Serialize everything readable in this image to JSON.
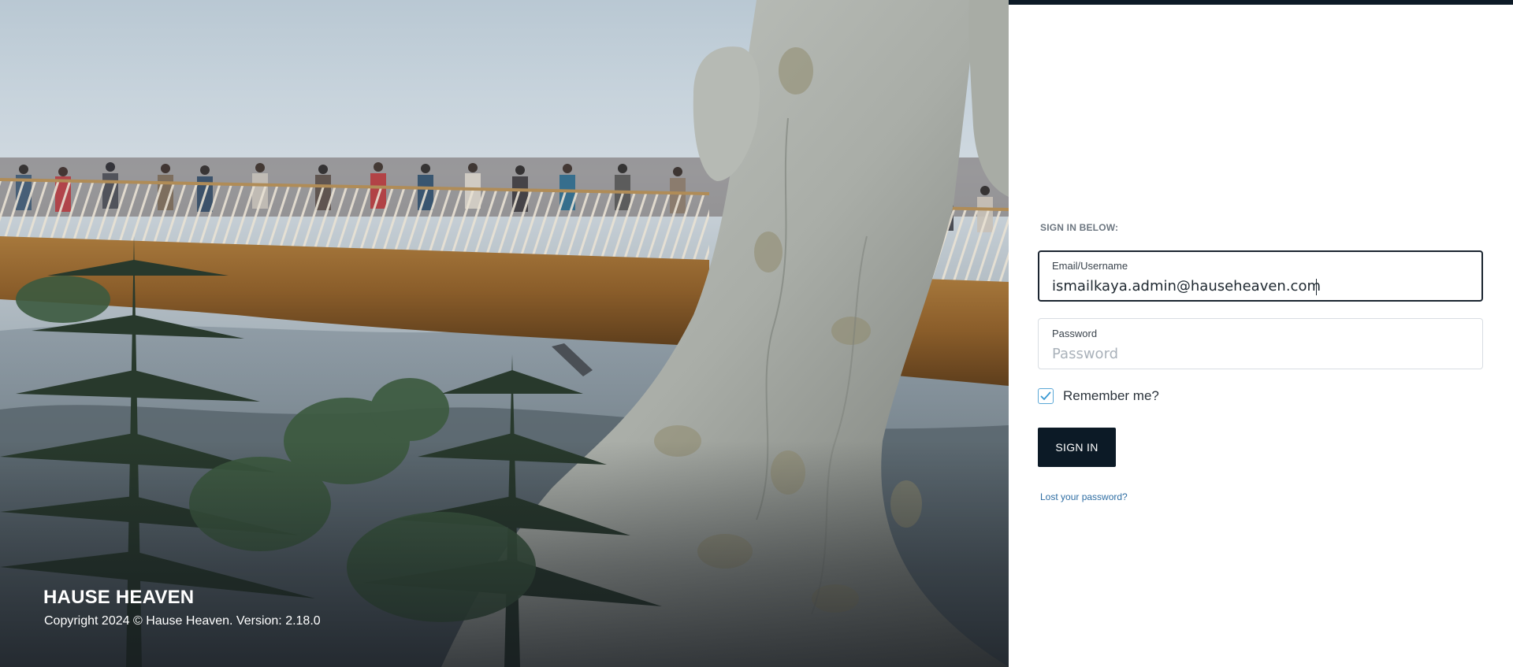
{
  "hero": {
    "image_alt": "Golden Bridge held by giant stone hands",
    "brand": "HAUSE HEAVEN",
    "copyright": "Copyright 2024 © Hause Heaven. Version: 2.18.0"
  },
  "signin": {
    "heading": "SIGN IN BELOW:",
    "email": {
      "label": "Email/Username",
      "value": "ismailkaya.admin@hauseheaven.com"
    },
    "password": {
      "label": "Password",
      "placeholder": "Password",
      "value": ""
    },
    "remember": {
      "label": "Remember me?",
      "checked": true
    },
    "submit_label": "SIGN IN",
    "lost_password_label": "Lost your password?"
  },
  "colors": {
    "accent_dark": "#0c1a26",
    "link": "#2f6ea3",
    "checkbox": "#5aa7d6"
  }
}
